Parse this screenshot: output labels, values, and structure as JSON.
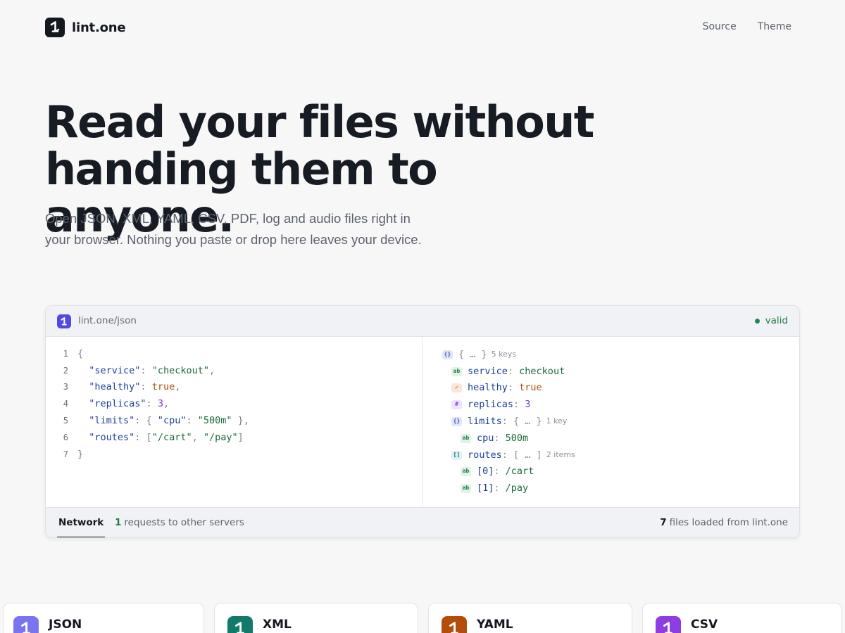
{
  "brand": {
    "name": "lint.one"
  },
  "nav": {
    "items": [
      {
        "label": "Source"
      },
      {
        "label": "Theme"
      }
    ]
  },
  "hero": {
    "title_line1": "Read your files without",
    "title_line2": "handing them to anyone.",
    "subtitle": "Open JSON, XML, YAML, CSV, PDF, log and audio files right in your browser. Nothing you paste or drop here leaves your device."
  },
  "panel": {
    "url": "lint.one/json",
    "status": "valid",
    "code_lines": [
      "1",
      "2",
      "3",
      "4",
      "5",
      "6",
      "7"
    ],
    "code": {
      "service_key": "\"service\"",
      "service_val": "\"checkout\"",
      "healthy_key": "\"healthy\"",
      "healthy_val": "true",
      "replicas_key": "\"replicas\"",
      "replicas_val": "3",
      "limits_key": "\"limits\"",
      "cpu_key": "\"cpu\"",
      "cpu_val": "\"500m\"",
      "routes_key": "\"routes\"",
      "route0": "\"/cart\"",
      "route1": "\"/pay\""
    },
    "tree": {
      "root_hint": "5 keys",
      "service": {
        "key": "service",
        "value": "checkout"
      },
      "healthy": {
        "key": "healthy",
        "value": "true"
      },
      "replicas": {
        "key": "replicas",
        "value": "3"
      },
      "limits": {
        "key": "limits",
        "hint": "1 key"
      },
      "cpu": {
        "key": "cpu",
        "value": "500m"
      },
      "routes": {
        "key": "routes",
        "hint": "2 items"
      },
      "route0": {
        "key": "[0]",
        "value": "/cart"
      },
      "route1": {
        "key": "[1]",
        "value": "/pay"
      }
    },
    "footer": {
      "tab": "Network",
      "requests_count": "1",
      "requests_label": "requests to other servers",
      "files_count": "7",
      "files_label": "files loaded from lint.one"
    }
  },
  "cards": [
    {
      "label": "JSON",
      "color": "#7b74f0"
    },
    {
      "label": "XML",
      "color": "#137a6a"
    },
    {
      "label": "YAML",
      "color": "#b24d0c"
    },
    {
      "label": "CSV",
      "color": "#8e3ee0"
    }
  ],
  "colors": {
    "accent": "#5548e0",
    "valid": "#1f8a4c",
    "ink": "#14181f"
  }
}
